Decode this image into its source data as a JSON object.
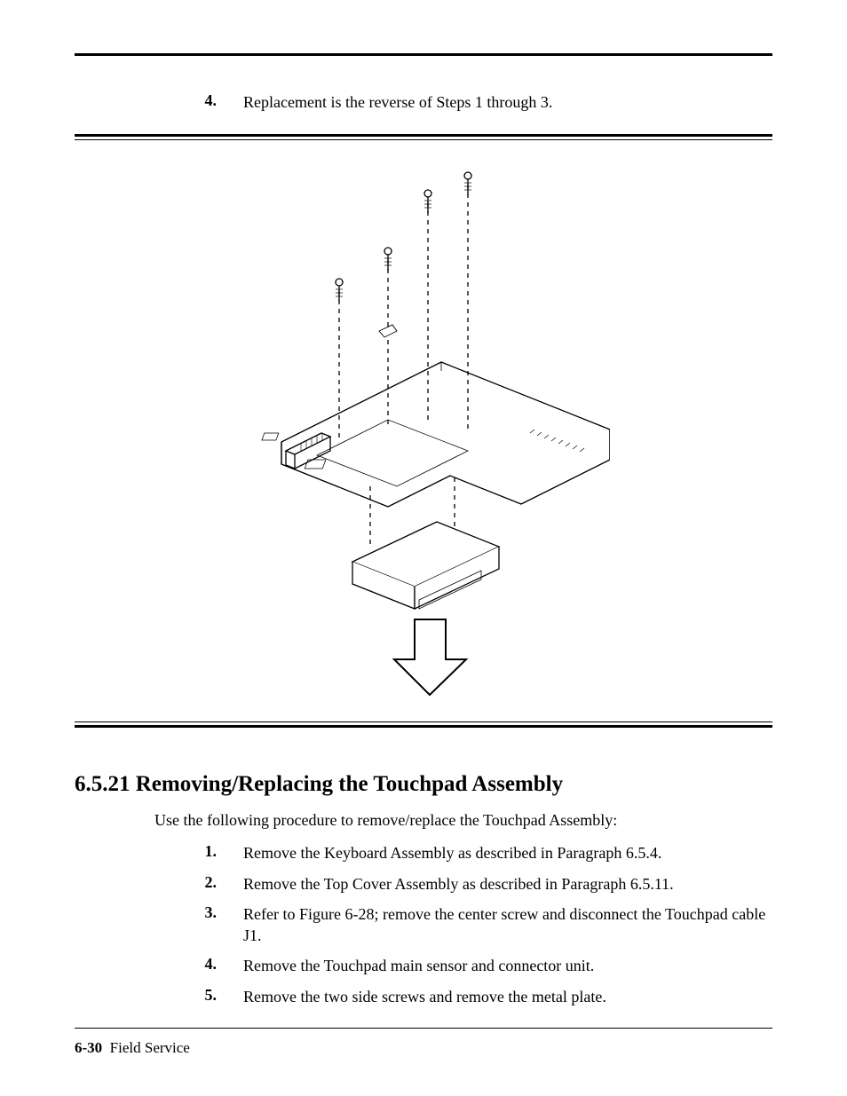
{
  "top_step": {
    "num": "4.",
    "text": "Replacement is the reverse of Steps 1 through 3."
  },
  "section": {
    "heading": "6.5.21  Removing/Replacing the Touchpad Assembly",
    "intro": "Use the following procedure to remove/replace the Touchpad Assembly:",
    "steps": [
      {
        "num": "1.",
        "text": "Remove the Keyboard Assembly as described in Paragraph 6.5.4."
      },
      {
        "num": "2.",
        "text": "Remove the Top Cover Assembly as described in Paragraph 6.5.11."
      },
      {
        "num": "3.",
        "text": "Refer to Figure 6-28;  remove the center screw and disconnect the Touchpad cable J1."
      },
      {
        "num": "4.",
        "text": "Remove the Touchpad main sensor and connector unit."
      },
      {
        "num": "5.",
        "text": "Remove the two side screws and remove the metal plate."
      }
    ]
  },
  "footer": {
    "page_label": "6-30",
    "chapter_label": "Field Service"
  }
}
